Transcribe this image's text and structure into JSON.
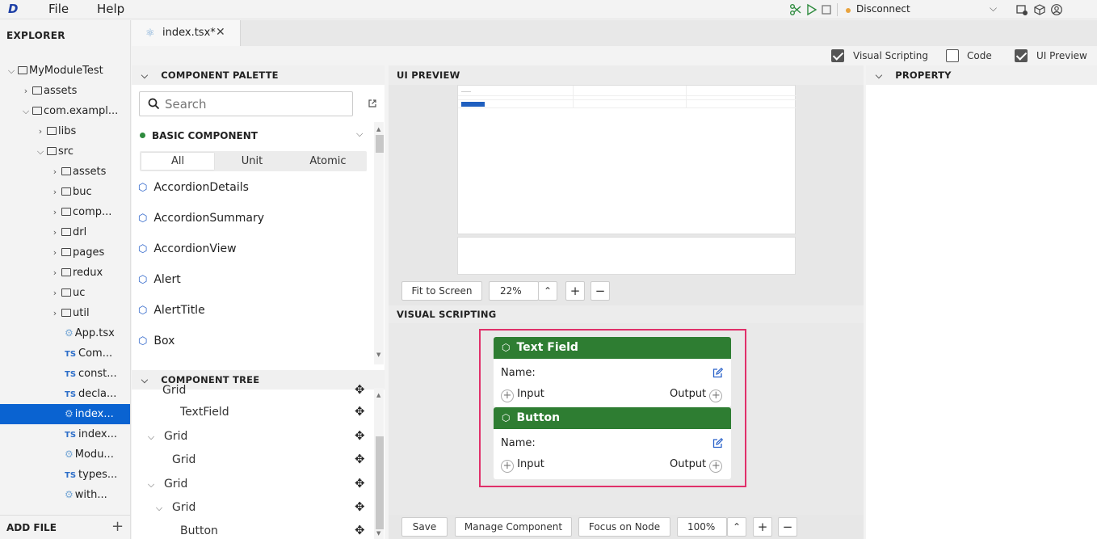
{
  "menubar": {
    "logo": "D",
    "items": [
      "File",
      "Help"
    ],
    "status": "Disconnect",
    "colors": {
      "status_dot": "#e8a33d"
    }
  },
  "explorer": {
    "title": "EXPLORER",
    "rows": [
      {
        "label": "MyModuleTest",
        "type": "folder",
        "expanded": true
      },
      {
        "label": "assets",
        "type": "folder",
        "expanded": false
      },
      {
        "label": "com.exampl...",
        "type": "folder",
        "expanded": true
      },
      {
        "label": "libs",
        "type": "folder",
        "expanded": false
      },
      {
        "label": "src",
        "type": "folder",
        "expanded": true
      },
      {
        "label": "assets",
        "type": "folder",
        "expanded": false
      },
      {
        "label": "buc",
        "type": "folder",
        "expanded": false
      },
      {
        "label": "comp...",
        "type": "folder",
        "expanded": false
      },
      {
        "label": "drl",
        "type": "folder",
        "expanded": false
      },
      {
        "label": "pages",
        "type": "folder",
        "expanded": false
      },
      {
        "label": "redux",
        "type": "folder",
        "expanded": false
      },
      {
        "label": "uc",
        "type": "folder",
        "expanded": false
      },
      {
        "label": "util",
        "type": "folder",
        "expanded": false
      },
      {
        "label": "App.tsx",
        "type": "react"
      },
      {
        "label": "Com...",
        "type": "ts"
      },
      {
        "label": "const...",
        "type": "ts"
      },
      {
        "label": "decla...",
        "type": "ts"
      },
      {
        "label": "index...",
        "type": "react",
        "selected": true
      },
      {
        "label": "index...",
        "type": "ts"
      },
      {
        "label": "Modu...",
        "type": "react"
      },
      {
        "label": "types...",
        "type": "ts"
      },
      {
        "label": "with...",
        "type": "react"
      }
    ],
    "add_file": "ADD FILE"
  },
  "tab": {
    "label": "index.tsx*"
  },
  "toggles": [
    {
      "label": "Visual Scripting",
      "checked": true
    },
    {
      "label": "Code",
      "checked": false
    },
    {
      "label": "UI Preview",
      "checked": true
    }
  ],
  "palette": {
    "title": "COMPONENT PALETTE",
    "search_placeholder": "Search",
    "group": "BASIC COMPONENT",
    "filters": [
      "All",
      "Unit",
      "Atomic"
    ],
    "active_filter": "All",
    "items": [
      "AccordionDetails",
      "AccordionSummary",
      "AccordionView",
      "Alert",
      "AlertTitle",
      "Box"
    ]
  },
  "component_tree": {
    "title": "COMPONENT TREE",
    "rows": [
      {
        "label": "Grid",
        "expanded": true
      },
      {
        "label": "TextField"
      },
      {
        "label": "Grid",
        "expanded": true
      },
      {
        "label": "Grid"
      },
      {
        "label": "Grid",
        "expanded": true
      },
      {
        "label": "Grid",
        "expanded": true
      },
      {
        "label": "Button"
      }
    ]
  },
  "ui_preview": {
    "title": "UI PREVIEW",
    "fit_label": "Fit to Screen",
    "zoom": "22%"
  },
  "visual_scripting": {
    "title": "VISUAL SCRIPTING",
    "nodes": [
      {
        "title": "Text Field",
        "name_label": "Name:",
        "input": "Input",
        "output": "Output"
      },
      {
        "title": "Button",
        "name_label": "Name:",
        "input": "Input",
        "output": "Output"
      }
    ],
    "controls": {
      "save": "Save",
      "manage": "Manage Component",
      "focus": "Focus on Node",
      "zoom": "100%"
    },
    "colors": {
      "node_header": "#2e7d32",
      "frame": "#e0306a"
    }
  },
  "property": {
    "title": "PROPERTY"
  }
}
